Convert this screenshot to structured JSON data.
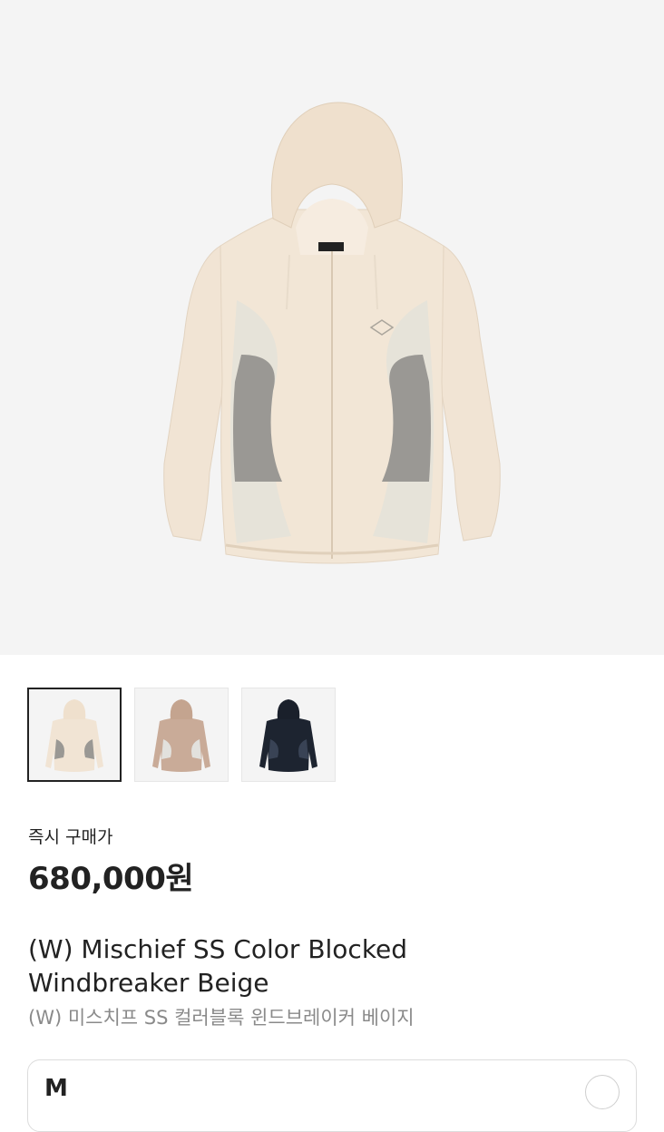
{
  "product": {
    "price_label": "즉시 구매가",
    "price": "680,000원",
    "title_en_line1": "(W) Mischief SS Color Blocked",
    "title_en_line2": "Windbreaker Beige",
    "title_ko": "(W) 미스치프 SS 컬러블록 윈드브레이커 베이지"
  },
  "thumbnails": [
    {
      "name": "beige",
      "body": "#f1e4d4",
      "panel": "#e6e3d9",
      "accent": "#9a9894",
      "selected": true
    },
    {
      "name": "brown",
      "body": "#c9ab98",
      "panel": "#e2e1dd",
      "accent": "#a99a8f",
      "selected": false
    },
    {
      "name": "navy",
      "body": "#1d2430",
      "panel": "#2a3140",
      "accent": "#394355",
      "selected": false
    }
  ],
  "size_selector": {
    "label": "M"
  },
  "colors": {
    "hero_bg": "#f4f4f4",
    "text_primary": "#222222",
    "text_secondary": "#8a8a8a"
  }
}
